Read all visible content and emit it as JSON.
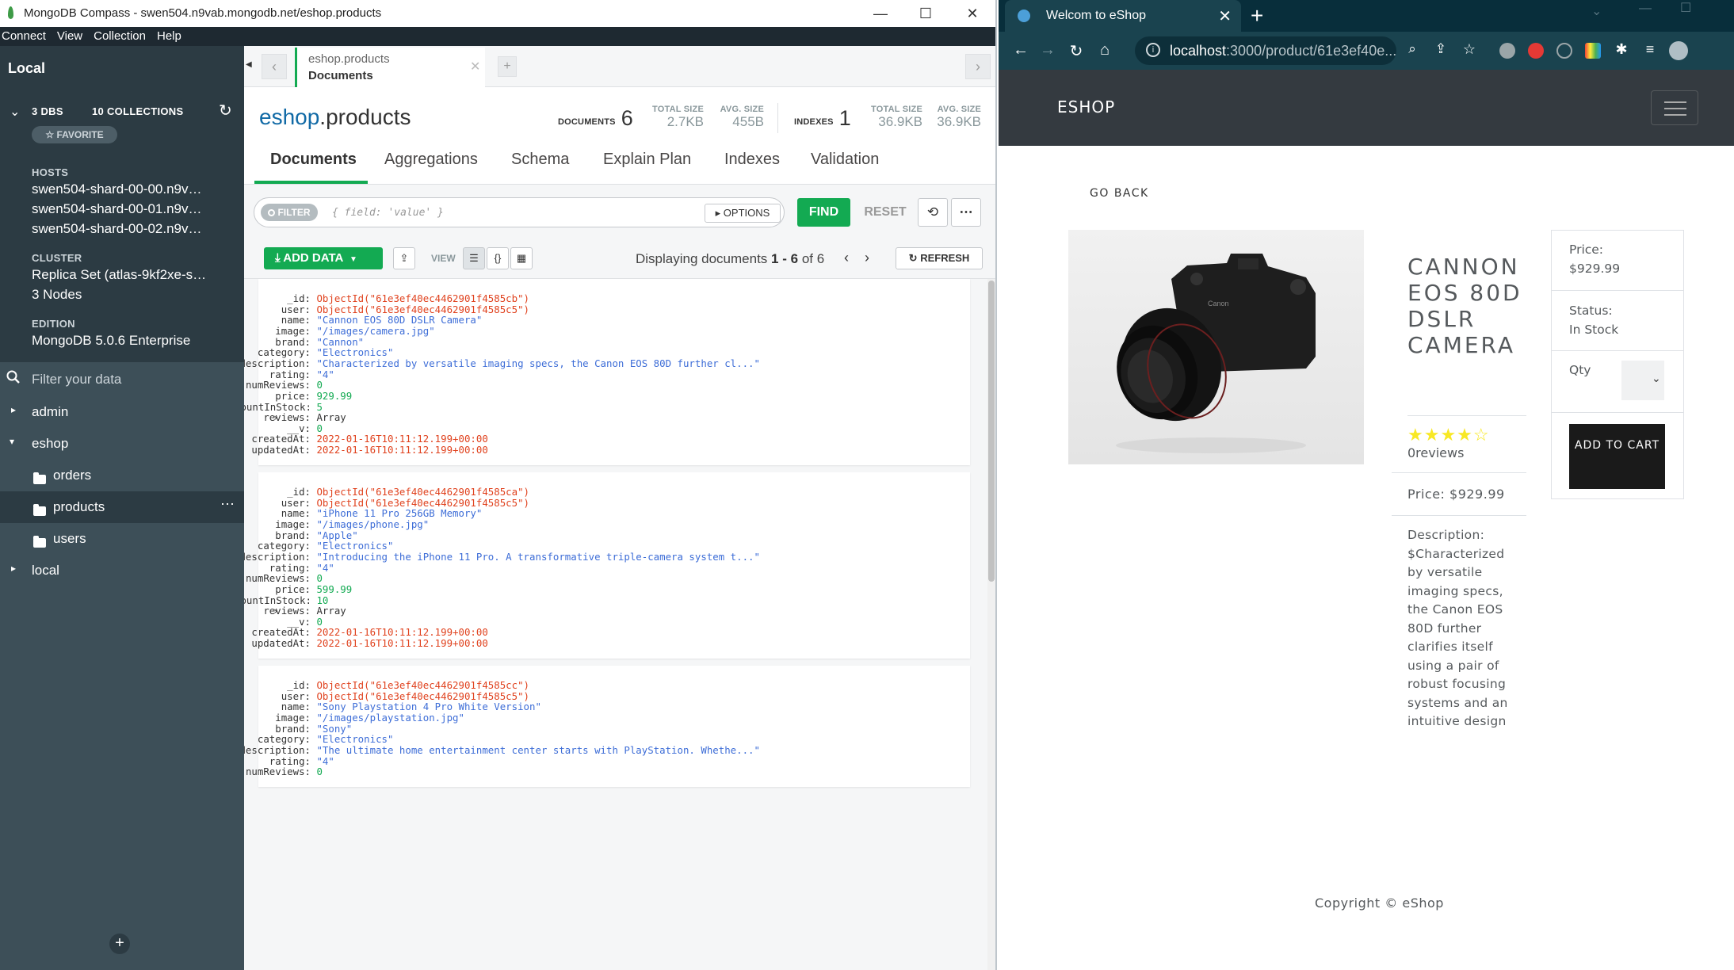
{
  "compass": {
    "window_title": "MongoDB Compass - swen504.n9vab.mongodb.net/eshop.products",
    "win_controls": [
      "—",
      "☐",
      "✕"
    ],
    "menu": [
      "Connect",
      "View",
      "Collection",
      "Help"
    ],
    "sidebar": {
      "local": "Local",
      "dbs": "3 DBS",
      "collections": "10 COLLECTIONS",
      "favorite": "☆ FAVORITE",
      "hosts_label": "HOSTS",
      "hosts": [
        "swen504-shard-00-00.n9v…",
        "swen504-shard-00-01.n9v…",
        "swen504-shard-00-02.n9v…"
      ],
      "cluster_label": "CLUSTER",
      "cluster": "Replica Set (atlas-9kf2xe-s…",
      "nodes": "3 Nodes",
      "edition_label": "EDITION",
      "edition": "MongoDB 5.0.6 Enterprise",
      "filter_placeholder": "Filter your data",
      "tree": {
        "admin": "admin",
        "eshop": "eshop",
        "orders": "orders",
        "products": "products",
        "users": "users",
        "local": "local"
      }
    },
    "tab": {
      "ns": "eshop.products",
      "label": "Documents"
    },
    "header": {
      "db": "eshop",
      "coll": ".products",
      "documents_label": "DOCUMENTS",
      "documents_count": "6",
      "total_size_label": "TOTAL SIZE",
      "total_size": "2.7KB",
      "avg_size_label": "AVG. SIZE",
      "avg_size": "455B",
      "indexes_label": "INDEXES",
      "indexes_count": "1",
      "idx_total_size_label": "TOTAL SIZE",
      "idx_total_size": "36.9KB",
      "idx_avg_size_label": "AVG. SIZE",
      "idx_avg_size": "36.9KB"
    },
    "subtabs": [
      "Documents",
      "Aggregations",
      "Schema",
      "Explain Plan",
      "Indexes",
      "Validation"
    ],
    "query": {
      "filter_pill": "FILTER",
      "filter_placeholder": "{ field: 'value' }",
      "options": "▸ OPTIONS",
      "find": "FIND",
      "reset": "RESET"
    },
    "toolbar": {
      "add_data": "ADD DATA",
      "view": "VIEW",
      "display_prefix": "Displaying documents",
      "display_range": "1 - 6",
      "display_of": "of 6",
      "refresh": "REFRESH"
    },
    "documents": [
      {
        "_id": "ObjectId(\"61e3ef40ec4462901f4585cb\")",
        "user": "ObjectId(\"61e3ef40ec4462901f4585c5\")",
        "name": "\"Cannon EOS 80D DSLR Camera\"",
        "image": "\"/images/camera.jpg\"",
        "brand": "\"Cannon\"",
        "category": "\"Electronics\"",
        "description": "\"Characterized by versatile imaging specs, the Canon EOS 80D further cl...\"",
        "rating": "\"4\"",
        "numReviews": "0",
        "price": "929.99",
        "countInStock": "5",
        "reviews": "Array",
        "__v": "0",
        "createdAt": "2022-01-16T10:11:12.199+00:00",
        "updatedAt": "2022-01-16T10:11:12.199+00:00"
      },
      {
        "_id": "ObjectId(\"61e3ef40ec4462901f4585ca\")",
        "user": "ObjectId(\"61e3ef40ec4462901f4585c5\")",
        "name": "\"iPhone 11 Pro 256GB Memory\"",
        "image": "\"/images/phone.jpg\"",
        "brand": "\"Apple\"",
        "category": "\"Electronics\"",
        "description": "\"Introducing the iPhone 11 Pro. A transformative triple-camera system t...\"",
        "rating": "\"4\"",
        "numReviews": "0",
        "price": "599.99",
        "countInStock": "10",
        "reviews": "Array",
        "__v": "0",
        "createdAt": "2022-01-16T10:11:12.199+00:00",
        "updatedAt": "2022-01-16T10:11:12.199+00:00"
      },
      {
        "_id": "ObjectId(\"61e3ef40ec4462901f4585cc\")",
        "user": "ObjectId(\"61e3ef40ec4462901f4585c5\")",
        "name": "\"Sony Playstation 4 Pro White Version\"",
        "image": "\"/images/playstation.jpg\"",
        "brand": "\"Sony\"",
        "category": "\"Electronics\"",
        "description": "\"The ultimate home entertainment center starts with PlayStation. Whethe...\"",
        "rating": "\"4\"",
        "numReviews": "0"
      }
    ]
  },
  "chrome": {
    "tab_title": "Welcom to eShop",
    "url_host": "localhost",
    "url_path": ":3000/product/61e3ef40e...",
    "eshop": {
      "brand": "ESHOP",
      "go_back": "GO BACK",
      "title": "CANNON EOS 80D DSLR CAMERA",
      "stars": "★★★★☆",
      "rating": 4,
      "reviews": "0reviews",
      "price_line": "Price: $929.99",
      "description": "Description: $Characterized by versatile imaging specs, the Canon EOS 80D further clarifies itself using a pair of robust focusing systems and an intuitive design",
      "card": {
        "price_label": "Price:",
        "price": "$929.99",
        "status_label": "Status:",
        "status": "In Stock",
        "qty_label": "Qty",
        "add_to_cart": "ADD TO CART"
      },
      "copyright": "Copyright © eShop"
    }
  }
}
